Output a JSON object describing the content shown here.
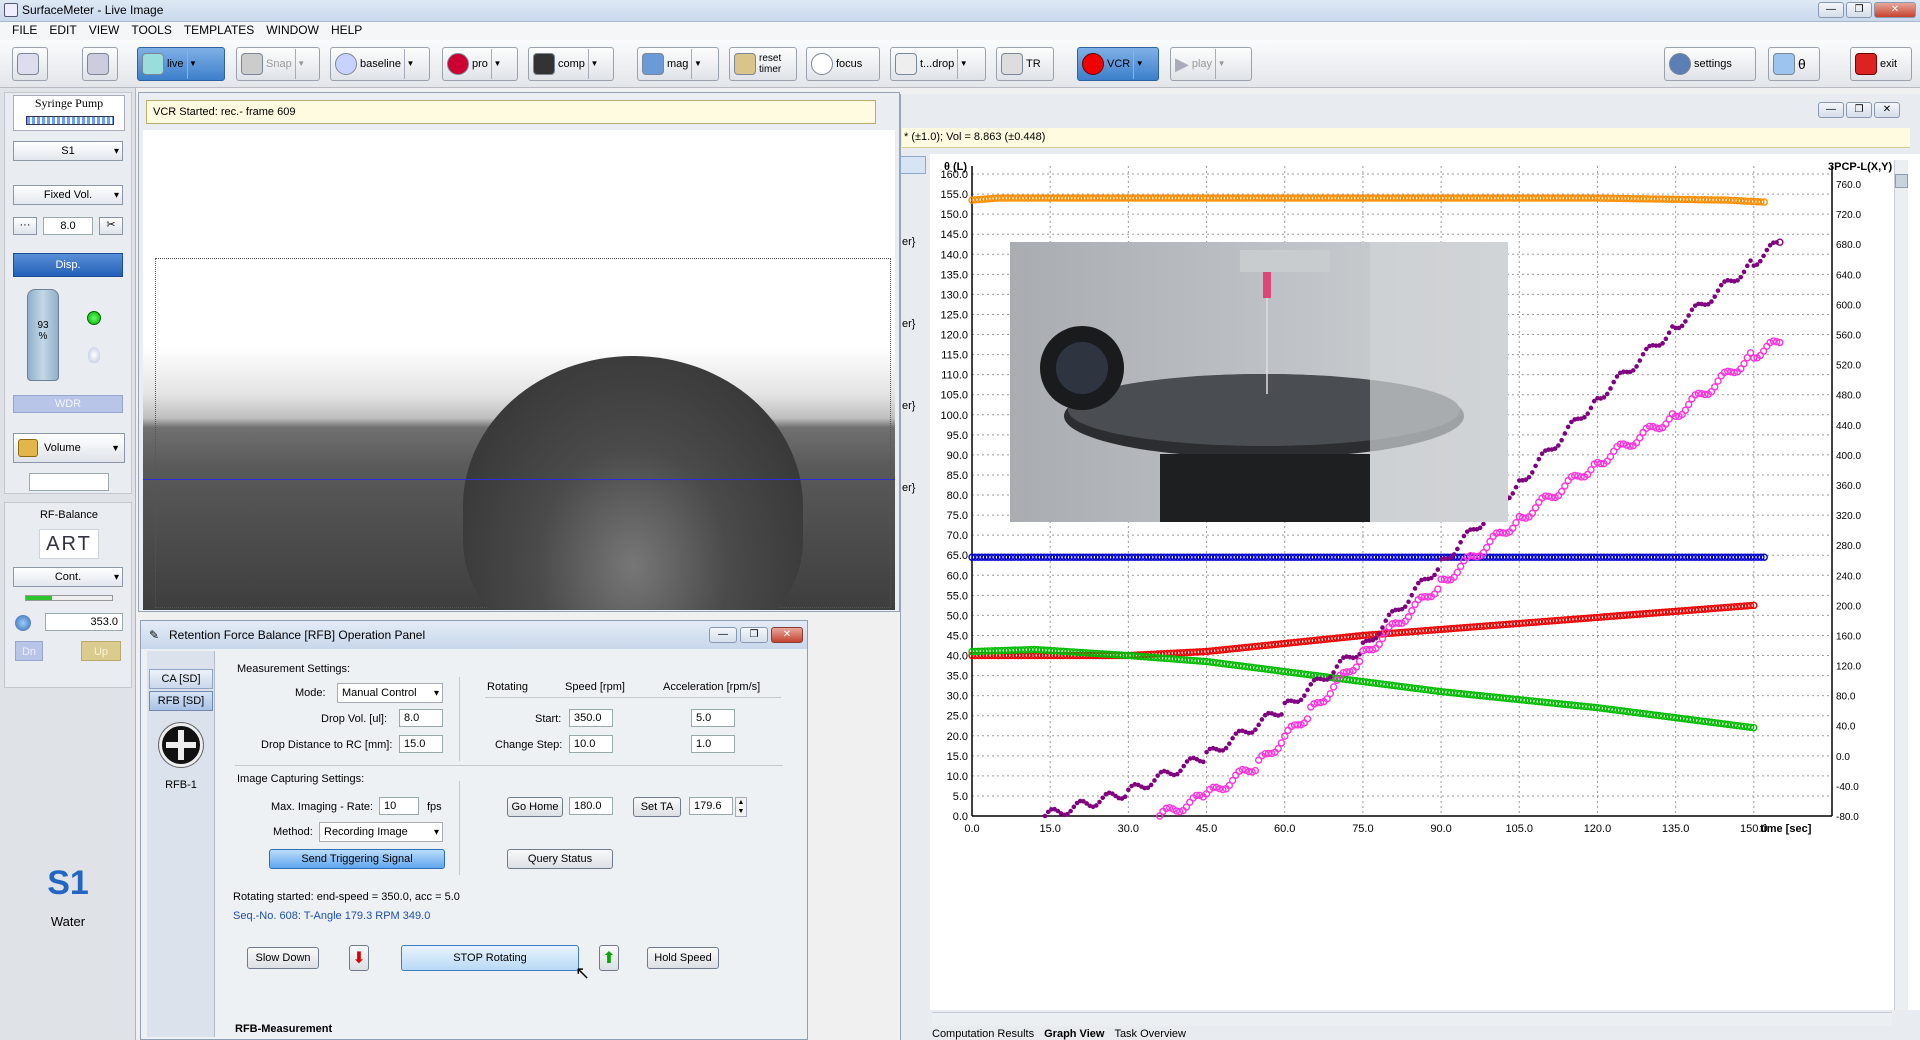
{
  "window": {
    "title": "SurfaceMeter - Live Image"
  },
  "menu": [
    "FILE",
    "EDIT",
    "VIEW",
    "TOOLS",
    "TEMPLATES",
    "WINDOW",
    "HELP"
  ],
  "toolbar": {
    "live": "live",
    "snap": "Snap",
    "baseline": "baseline",
    "pro": "pro",
    "comp": "comp",
    "mag": "mag",
    "reset_timer_1": "reset",
    "reset_timer_2": "timer",
    "focus": "focus",
    "tdrop": "t...drop",
    "tr": "TR",
    "vcr": "VCR",
    "play": "play",
    "settings": "settings",
    "theta": "θ",
    "exit": "exit"
  },
  "left": {
    "pump_title": "Syringe Pump",
    "syringe_select": "S1",
    "mode_select": "Fixed Vol.",
    "volume_value": "8.0",
    "disp_label": "Disp.",
    "level_1": "93",
    "level_2": "%",
    "wdr_label": "WDR",
    "volume_select": "Volume",
    "rf_title": "RF-Balance",
    "art_logo": "ART",
    "cont_select": "Cont.",
    "speed_value": "353.0",
    "dn_label": "Dn",
    "up_label": "Up",
    "s1_big": "S1",
    "liquid": "Water"
  },
  "image": {
    "status": "VCR Started: rec.- frame 609"
  },
  "graph": {
    "status": "* (±1.0); Vol = 8.863 (±0.448)",
    "side_labels": [
      "er}",
      "er}",
      "er}",
      "er}"
    ],
    "tabs": [
      "Computation Results",
      "Graph View",
      "Task Overview"
    ]
  },
  "panel": {
    "title": "Retention Force Balance [RFB] Operation Panel",
    "tab_ca": "CA [SD]",
    "tab_rfb": "RFB [SD]",
    "device": "RFB-1",
    "meas_settings": "Measurement Settings:",
    "mode_label": "Mode:",
    "mode_value": "Manual Control",
    "dropvol_label": "Drop Vol. [ul]:",
    "dropvol_value": "8.0",
    "dropdist_label": "Drop Distance to RC [mm]:",
    "dropdist_value": "15.0",
    "rotating": "Rotating",
    "speed_hdr": "Speed [rpm]",
    "acc_hdr": "Acceleration [rpm/s]",
    "start_label": "Start:",
    "start_speed": "350.0",
    "start_acc": "5.0",
    "step_label": "Change Step:",
    "step_speed": "10.0",
    "step_acc": "1.0",
    "img_settings": "Image Capturing Settings:",
    "rate_label": "Max. Imaging - Rate:",
    "rate_value": "10",
    "fps": "fps",
    "method_label": "Method:",
    "method_value": "Recording Image",
    "trigger_btn": "Send Triggering Signal",
    "gohome_btn": "Go Home",
    "gohome_value": "180.0",
    "setta_btn": "Set TA",
    "setta_value": "179.6",
    "query_btn": "Query Status",
    "msg1": "Rotating started: end-speed = 350.0, acc = 5.0",
    "msg2": "Seq.-No. 608: T-Angle 179.3  RPM 349.0",
    "slow_btn": "Slow Down",
    "stop_btn": "STOP Rotating",
    "hold_btn": "Hold Speed",
    "bottom_tab": "RFB-Measurement"
  },
  "chart_data": {
    "type": "scatter",
    "ylabel": "θ (L)",
    "y2label": "3PCP-L(X,Y)",
    "xlabel": "time [sec]",
    "xlim": [
      0,
      165
    ],
    "ylim": [
      0,
      162
    ],
    "y2lim": [
      -80,
      784
    ],
    "x_ticks": [
      "0.0",
      "15.0",
      "30.0",
      "45.0",
      "60.0",
      "75.0",
      "90.0",
      "105.0",
      "120.0",
      "135.0",
      "150.0"
    ],
    "y_ticks": [
      "0.0",
      "5.0",
      "10.0",
      "15.0",
      "20.0",
      "25.0",
      "30.0",
      "35.0",
      "40.0",
      "45.0",
      "50.0",
      "55.0",
      "60.0",
      "65.0",
      "70.0",
      "75.0",
      "80.0",
      "85.0",
      "90.0",
      "95.0",
      "100.0",
      "105.0",
      "110.0",
      "115.0",
      "120.0",
      "125.0",
      "130.0",
      "135.0",
      "140.0",
      "145.0",
      "150.0",
      "155.0",
      "160.0"
    ],
    "y2_ticks": [
      "-80.0",
      "-40.0",
      "0.0",
      "40.0",
      "80.0",
      "120.0",
      "160.0",
      "200.0",
      "240.0",
      "280.0",
      "320.0",
      "360.0",
      "400.0",
      "440.0",
      "480.0",
      "520.0",
      "560.0",
      "600.0",
      "640.0",
      "680.0",
      "720.0",
      "760.0"
    ],
    "grid": true,
    "series": [
      {
        "color": "#ff8c00",
        "values": [
          [
            0,
            153.5
          ],
          [
            5,
            154
          ],
          [
            12,
            154
          ],
          [
            30,
            154
          ],
          [
            60,
            154
          ],
          [
            90,
            154
          ],
          [
            120,
            154
          ],
          [
            145,
            153.5
          ],
          [
            152,
            153
          ]
        ]
      },
      {
        "color": "#0000cc",
        "values": [
          [
            0,
            64.5
          ],
          [
            5,
            64.5
          ],
          [
            12,
            64.5
          ],
          [
            30,
            64.5
          ],
          [
            60,
            64.5
          ],
          [
            90,
            64.5
          ],
          [
            120,
            64.5
          ],
          [
            152,
            64.5
          ]
        ]
      },
      {
        "color": "#ee0000",
        "values": [
          [
            0,
            40
          ],
          [
            12,
            40
          ],
          [
            30,
            40
          ],
          [
            45,
            41
          ],
          [
            60,
            43
          ],
          [
            75,
            45
          ],
          [
            90,
            46.5
          ],
          [
            105,
            48
          ],
          [
            120,
            49.5
          ],
          [
            135,
            51
          ],
          [
            150,
            52.5
          ]
        ]
      },
      {
        "color": "#00bb00",
        "values": [
          [
            0,
            41
          ],
          [
            12,
            41.5
          ],
          [
            30,
            40
          ],
          [
            45,
            38.5
          ],
          [
            60,
            36
          ],
          [
            75,
            33.5
          ],
          [
            90,
            31
          ],
          [
            105,
            29
          ],
          [
            120,
            27
          ],
          [
            135,
            24.5
          ],
          [
            150,
            22
          ]
        ]
      },
      {
        "color": "#800080",
        "values": [
          [
            14,
            0
          ],
          [
            30,
            6
          ],
          [
            45,
            15
          ],
          [
            60,
            27
          ],
          [
            75,
            42
          ],
          [
            90,
            63
          ],
          [
            105,
            83
          ],
          [
            120,
            104
          ],
          [
            135,
            122
          ],
          [
            150,
            138
          ],
          [
            155,
            143
          ]
        ]
      },
      {
        "color": "#ff33dd",
        "values": [
          [
            36,
            0
          ],
          [
            45,
            5
          ],
          [
            55,
            13
          ],
          [
            65,
            26
          ],
          [
            75,
            40
          ],
          [
            90,
            58
          ],
          [
            105,
            74
          ],
          [
            120,
            88
          ],
          [
            135,
            100
          ],
          [
            150,
            115
          ],
          [
            155,
            118
          ]
        ]
      }
    ]
  }
}
